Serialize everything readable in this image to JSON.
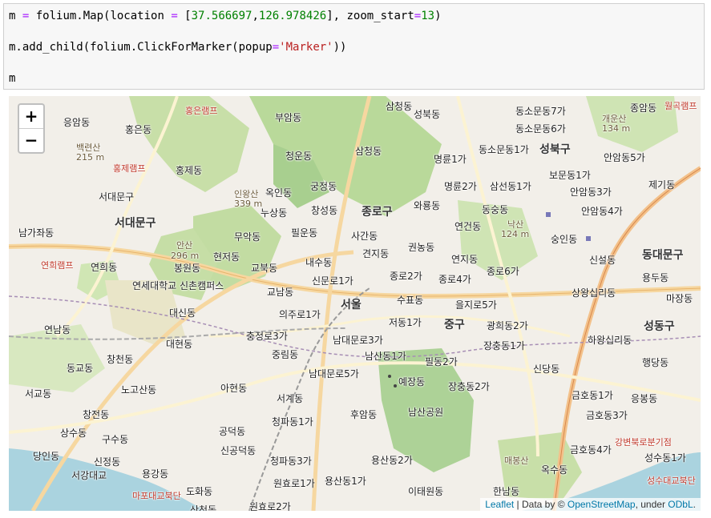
{
  "code_cell": {
    "line1": {
      "a": "m ",
      "b": "=",
      "c": " folium.Map(location ",
      "d": "=",
      "e": " [",
      "f": "37.566697",
      "g": ",",
      "h": "126.978426",
      "i": "], zoom_start",
      "j": "=",
      "k": "13",
      "l": ")"
    },
    "line2": {
      "a": "m.add_child(folium.ClickForMarker(popup",
      "b": "=",
      "c": "'Marker'",
      "d": "))"
    },
    "line3": "m"
  },
  "map": {
    "zoom_in": "+",
    "zoom_out": "−",
    "attribution": {
      "leaflet": "Leaflet",
      "sep1": " | Data by © ",
      "osm": "OpenStreetMap",
      "sep2": ", under ",
      "odbl": "ODbL",
      "end": "."
    },
    "labels": [
      {
        "t": "홍은램프",
        "c": "red"
      },
      {
        "t": "부암동"
      },
      {
        "t": "삼청동"
      },
      {
        "t": "성북동"
      },
      {
        "t": "동소문동7가"
      },
      {
        "t": "종암동"
      },
      {
        "t": "월곡램프",
        "c": "red"
      },
      {
        "t": "응암동"
      },
      {
        "t": "홍은동"
      },
      {
        "t": "동소문동6가"
      },
      {
        "t": "개운산",
        "c": "mtn"
      },
      {
        "t": "134 m",
        "c": "mtn"
      },
      {
        "t": "백련산",
        "c": "mtn"
      },
      {
        "t": "215 m",
        "c": "mtn"
      },
      {
        "t": "홍제램프",
        "c": "red"
      },
      {
        "t": "청운동"
      },
      {
        "t": "삼청동"
      },
      {
        "t": "명륜1가"
      },
      {
        "t": "동소문동1가"
      },
      {
        "t": "성북구",
        "c": "big"
      },
      {
        "t": "안암동5가"
      },
      {
        "t": "홍제동"
      },
      {
        "t": "보문동1가"
      },
      {
        "t": "제기동"
      },
      {
        "t": "서대문구"
      },
      {
        "t": "인왕산",
        "c": "mtn"
      },
      {
        "t": "339 m",
        "c": "mtn"
      },
      {
        "t": "옥인동"
      },
      {
        "t": "궁정동"
      },
      {
        "t": "명륜2가"
      },
      {
        "t": "삼선동1가"
      },
      {
        "t": "안암동3가"
      },
      {
        "t": "누상동"
      },
      {
        "t": "창성동"
      },
      {
        "t": "종로구",
        "c": "big"
      },
      {
        "t": "와룡동"
      },
      {
        "t": "동숭동"
      },
      {
        "t": "안암동4가"
      },
      {
        "t": "서대문구",
        "c": "big"
      },
      {
        "t": "남가좌동"
      },
      {
        "t": "무악동"
      },
      {
        "t": "필운동"
      },
      {
        "t": "사간동"
      },
      {
        "t": "연건동"
      },
      {
        "t": "낙산",
        "c": "mtn"
      },
      {
        "t": "124 m",
        "c": "mtn"
      },
      {
        "t": "숭인동"
      },
      {
        "t": "안산",
        "c": "mtn"
      },
      {
        "t": "296 m",
        "c": "mtn"
      },
      {
        "t": "견지동"
      },
      {
        "t": "권농동"
      },
      {
        "t": "신설동"
      },
      {
        "t": "동대문구",
        "c": "big"
      },
      {
        "t": "연희램프",
        "c": "red"
      },
      {
        "t": "연희동"
      },
      {
        "t": "봉원동"
      },
      {
        "t": "현저동"
      },
      {
        "t": "교북동"
      },
      {
        "t": "내수동"
      },
      {
        "t": "연지동"
      },
      {
        "t": "종로6가"
      },
      {
        "t": "연세대학교 신촌캠퍼스"
      },
      {
        "t": "신문로1가"
      },
      {
        "t": "종로2가"
      },
      {
        "t": "종로4가"
      },
      {
        "t": "용두동"
      },
      {
        "t": "교남동"
      },
      {
        "t": "서울",
        "c": "big"
      },
      {
        "t": "수표동"
      },
      {
        "t": "을지로5가"
      },
      {
        "t": "상왕십리동"
      },
      {
        "t": "마장동"
      },
      {
        "t": "연남동"
      },
      {
        "t": "대신동"
      },
      {
        "t": "의주로1가"
      },
      {
        "t": "저동1가"
      },
      {
        "t": "중구",
        "c": "big"
      },
      {
        "t": "광희동2가"
      },
      {
        "t": "성동구",
        "c": "big"
      },
      {
        "t": "대현동"
      },
      {
        "t": "충정로3가"
      },
      {
        "t": "남대문로3가"
      },
      {
        "t": "장충동1가"
      },
      {
        "t": "하왕십리동"
      },
      {
        "t": "창천동"
      },
      {
        "t": "중림동"
      },
      {
        "t": "남산동1가"
      },
      {
        "t": "필동2가"
      },
      {
        "t": "신당동"
      },
      {
        "t": "행당동"
      },
      {
        "t": "동교동"
      },
      {
        "t": "남대문로5가"
      },
      {
        "t": "예장동"
      },
      {
        "t": "장충동2가"
      },
      {
        "t": "서교동"
      },
      {
        "t": "노고산동"
      },
      {
        "t": "아현동"
      },
      {
        "t": "서계동"
      },
      {
        "t": "후암동"
      },
      {
        "t": "금호동1가"
      },
      {
        "t": "응봉동"
      },
      {
        "t": "창전동"
      },
      {
        "t": "청파동1가"
      },
      {
        "t": "남산공원"
      },
      {
        "t": "금호동3가"
      },
      {
        "t": "상수동"
      },
      {
        "t": "구수동"
      },
      {
        "t": "공덕동"
      },
      {
        "t": "강변북로분기점",
        "c": "red"
      },
      {
        "t": "당인동"
      },
      {
        "t": "신정동"
      },
      {
        "t": "신공덕동"
      },
      {
        "t": "용산동2가"
      },
      {
        "t": "금호동4가"
      },
      {
        "t": "성수동1가"
      },
      {
        "t": "서강대교"
      },
      {
        "t": "용강동"
      },
      {
        "t": "청파동3가"
      },
      {
        "t": "매봉산",
        "c": "mtn"
      },
      {
        "t": "옥수동"
      },
      {
        "t": "마포대교북단",
        "c": "red"
      },
      {
        "t": "도화동"
      },
      {
        "t": "원효로1가"
      },
      {
        "t": "용산동1가"
      },
      {
        "t": "이태원동"
      },
      {
        "t": "한남동"
      },
      {
        "t": "성수대교북단",
        "c": "red"
      },
      {
        "t": "원효로2가"
      },
      {
        "t": "산천동"
      }
    ]
  }
}
